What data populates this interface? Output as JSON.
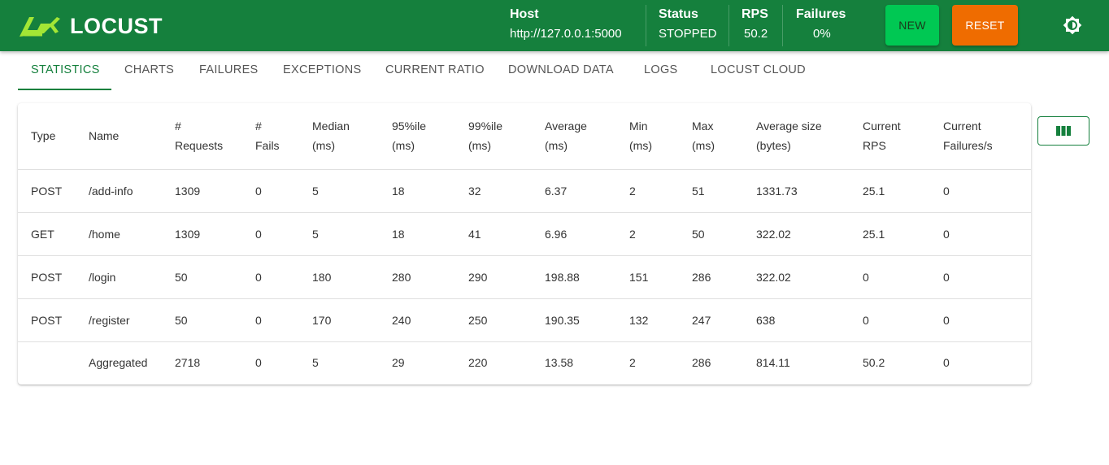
{
  "app": {
    "name": "LOCUST"
  },
  "header": {
    "host": {
      "label": "Host",
      "value": "http://127.0.0.1:5000"
    },
    "status": {
      "label": "Status",
      "value": "STOPPED"
    },
    "rps": {
      "label": "RPS",
      "value": "50.2"
    },
    "failures": {
      "label": "Failures",
      "value": "0%"
    },
    "new_label": "NEW",
    "reset_label": "RESET",
    "theme_icon": "brightness-icon"
  },
  "colors": {
    "brand": "#15803d",
    "new_button": "#00c853",
    "reset_button": "#ef6c00"
  },
  "tabs": [
    {
      "label": "STATISTICS",
      "active": true
    },
    {
      "label": "CHARTS"
    },
    {
      "label": "FAILURES"
    },
    {
      "label": "EXCEPTIONS"
    },
    {
      "label": "CURRENT RATIO"
    },
    {
      "label": "DOWNLOAD DATA"
    },
    {
      "label": "LOGS"
    },
    {
      "label": "LOCUST CLOUD"
    }
  ],
  "table": {
    "columns": [
      [
        "Type"
      ],
      [
        "Name"
      ],
      [
        "#",
        "Requests"
      ],
      [
        "#",
        "Fails"
      ],
      [
        "Median",
        "(ms)"
      ],
      [
        "95%ile",
        "(ms)"
      ],
      [
        "99%ile",
        "(ms)"
      ],
      [
        "Average",
        "(ms)"
      ],
      [
        "Min",
        "(ms)"
      ],
      [
        "Max",
        "(ms)"
      ],
      [
        "Average size",
        "(bytes)"
      ],
      [
        "Current",
        "RPS"
      ],
      [
        "Current",
        "Failures/s"
      ]
    ],
    "rows": [
      [
        "POST",
        "/add-info",
        "1309",
        "0",
        "5",
        "18",
        "32",
        "6.37",
        "2",
        "51",
        "1331.73",
        "25.1",
        "0"
      ],
      [
        "GET",
        "/home",
        "1309",
        "0",
        "5",
        "18",
        "41",
        "6.96",
        "2",
        "50",
        "322.02",
        "25.1",
        "0"
      ],
      [
        "POST",
        "/login",
        "50",
        "0",
        "180",
        "280",
        "290",
        "198.88",
        "151",
        "286",
        "322.02",
        "0",
        "0"
      ],
      [
        "POST",
        "/register",
        "50",
        "0",
        "170",
        "240",
        "250",
        "190.35",
        "132",
        "247",
        "638",
        "0",
        "0"
      ],
      [
        "",
        "Aggregated",
        "2718",
        "0",
        "5",
        "29",
        "220",
        "13.58",
        "2",
        "286",
        "814.11",
        "50.2",
        "0"
      ]
    ]
  },
  "column_selector_icon": "view-column-icon"
}
